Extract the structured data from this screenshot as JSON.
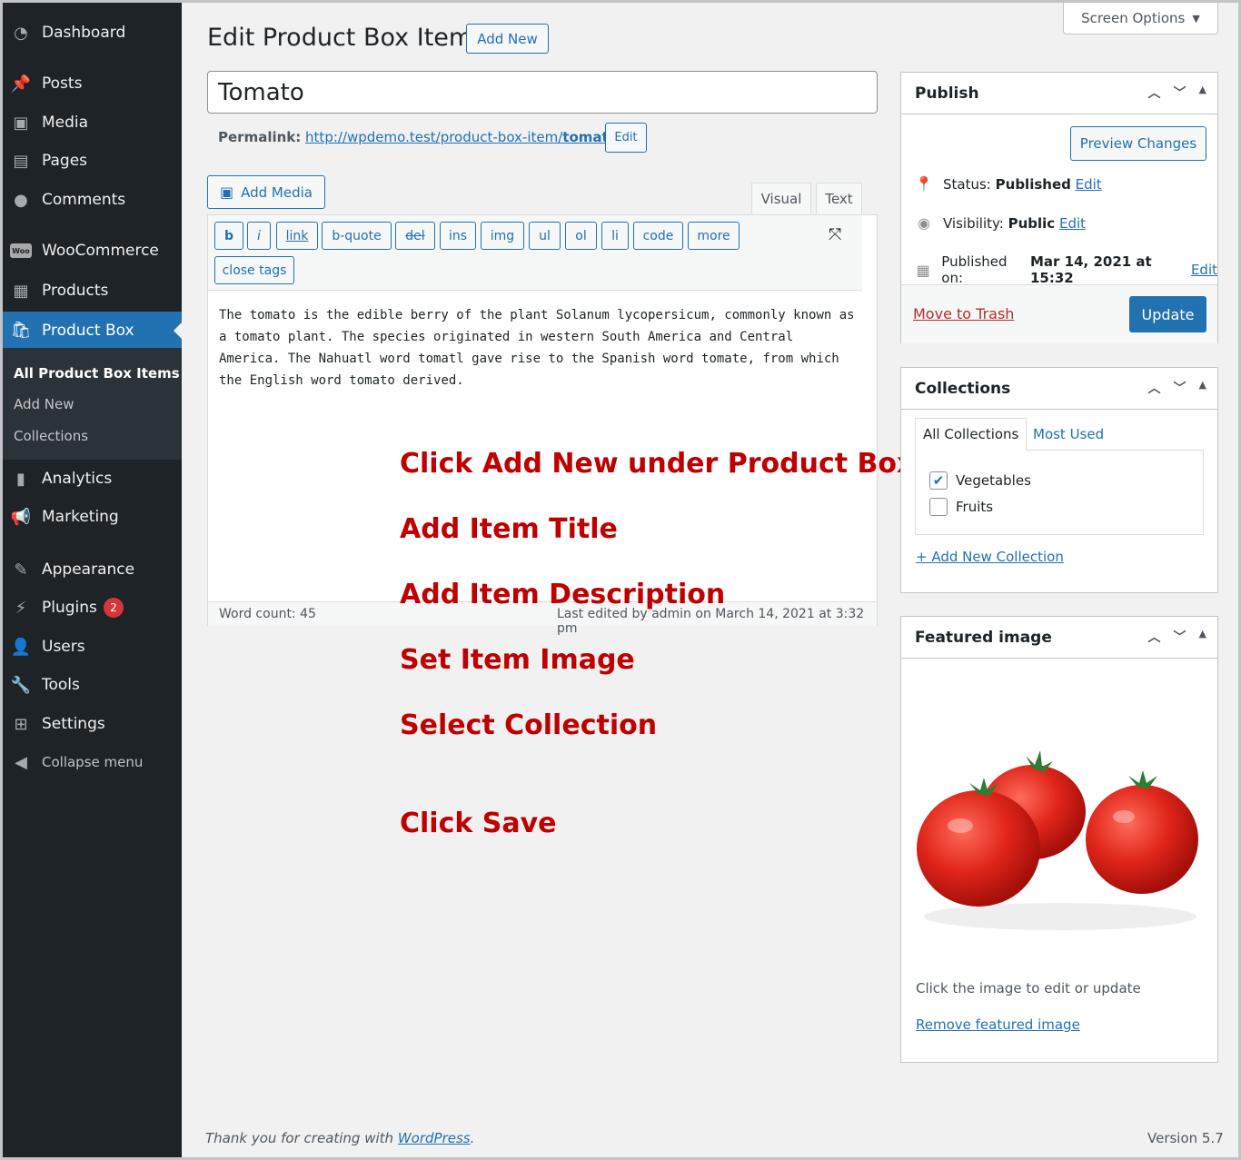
{
  "sidebar": {
    "items": [
      {
        "label": "Dashboard",
        "icon": "dashboard-icon"
      },
      {
        "label": "Posts",
        "icon": "pin-icon"
      },
      {
        "label": "Media",
        "icon": "media-icon"
      },
      {
        "label": "Pages",
        "icon": "pages-icon"
      },
      {
        "label": "Comments",
        "icon": "comments-icon"
      },
      {
        "label": "WooCommerce",
        "icon": "woo-icon"
      },
      {
        "label": "Products",
        "icon": "products-icon"
      },
      {
        "label": "Product Box",
        "icon": "product-box-icon"
      },
      {
        "label": "Analytics",
        "icon": "analytics-icon"
      },
      {
        "label": "Marketing",
        "icon": "megaphone-icon"
      },
      {
        "label": "Appearance",
        "icon": "brush-icon"
      },
      {
        "label": "Plugins",
        "icon": "plug-icon",
        "badge": "2"
      },
      {
        "label": "Users",
        "icon": "user-icon"
      },
      {
        "label": "Tools",
        "icon": "wrench-icon"
      },
      {
        "label": "Settings",
        "icon": "settings-icon"
      },
      {
        "label": "Collapse menu",
        "icon": "collapse-icon"
      }
    ],
    "woo_logo_text": "Woo",
    "submenu": [
      "All Product Box Items",
      "Add New",
      "Collections"
    ]
  },
  "header": {
    "title": "Edit Product Box Item",
    "add_new": "Add New",
    "screen_options": "Screen Options"
  },
  "post": {
    "title": "Tomato",
    "permalink_label": "Permalink:",
    "permalink_base": "http://wpdemo.test/product-box-item/",
    "permalink_slug": "tomato",
    "permalink_end": "/",
    "permalink_edit": "Edit"
  },
  "editor": {
    "add_media": "Add Media",
    "tab_visual": "Visual",
    "tab_text": "Text",
    "quicktags": [
      "b",
      "i",
      "link",
      "b-quote",
      "del",
      "ins",
      "img",
      "ul",
      "ol",
      "li",
      "code",
      "more",
      "close tags"
    ],
    "content": "The tomato is the edible berry of the plant Solanum lycopersicum, commonly known as a tomato plant. The species originated in western South America and Central America. The Nahuatl word tomatl gave rise to the Spanish word tomate, from which the English word tomato derived.",
    "word_count": "Word count: 45",
    "last_edited": "Last edited by admin on March 14, 2021 at 3:32 pm"
  },
  "annotations": [
    "Click Add New under Product Box",
    "Add Item Title",
    "Add Item Description",
    "Set Item Image",
    "Select Collection",
    "Click Save"
  ],
  "publish": {
    "title": "Publish",
    "preview": "Preview Changes",
    "status_label": "Status:",
    "status_value": "Published",
    "visibility_label": "Visibility:",
    "visibility_value": "Public",
    "published_label": "Published on:",
    "published_value": "Mar 14, 2021 at 15:32",
    "edit": "Edit",
    "trash": "Move to Trash",
    "update": "Update"
  },
  "collections": {
    "title": "Collections",
    "tab_all": "All Collections",
    "tab_used": "Most Used",
    "items": [
      {
        "label": "Vegetables",
        "checked": true
      },
      {
        "label": "Fruits",
        "checked": false
      }
    ],
    "add_new": "+ Add New Collection"
  },
  "featured": {
    "title": "Featured image",
    "hint": "Click the image to edit or update",
    "remove": "Remove featured image"
  },
  "footer": {
    "thanks": "Thank you for creating with ",
    "wordpress": "WordPress",
    "period": ".",
    "version": "Version 5.7"
  },
  "colors": {
    "accent": "#2271b1",
    "annotation": "#c00000",
    "sidebar_bg": "#1d2327",
    "trash": "#b32d2e",
    "badge": "#d63638"
  }
}
